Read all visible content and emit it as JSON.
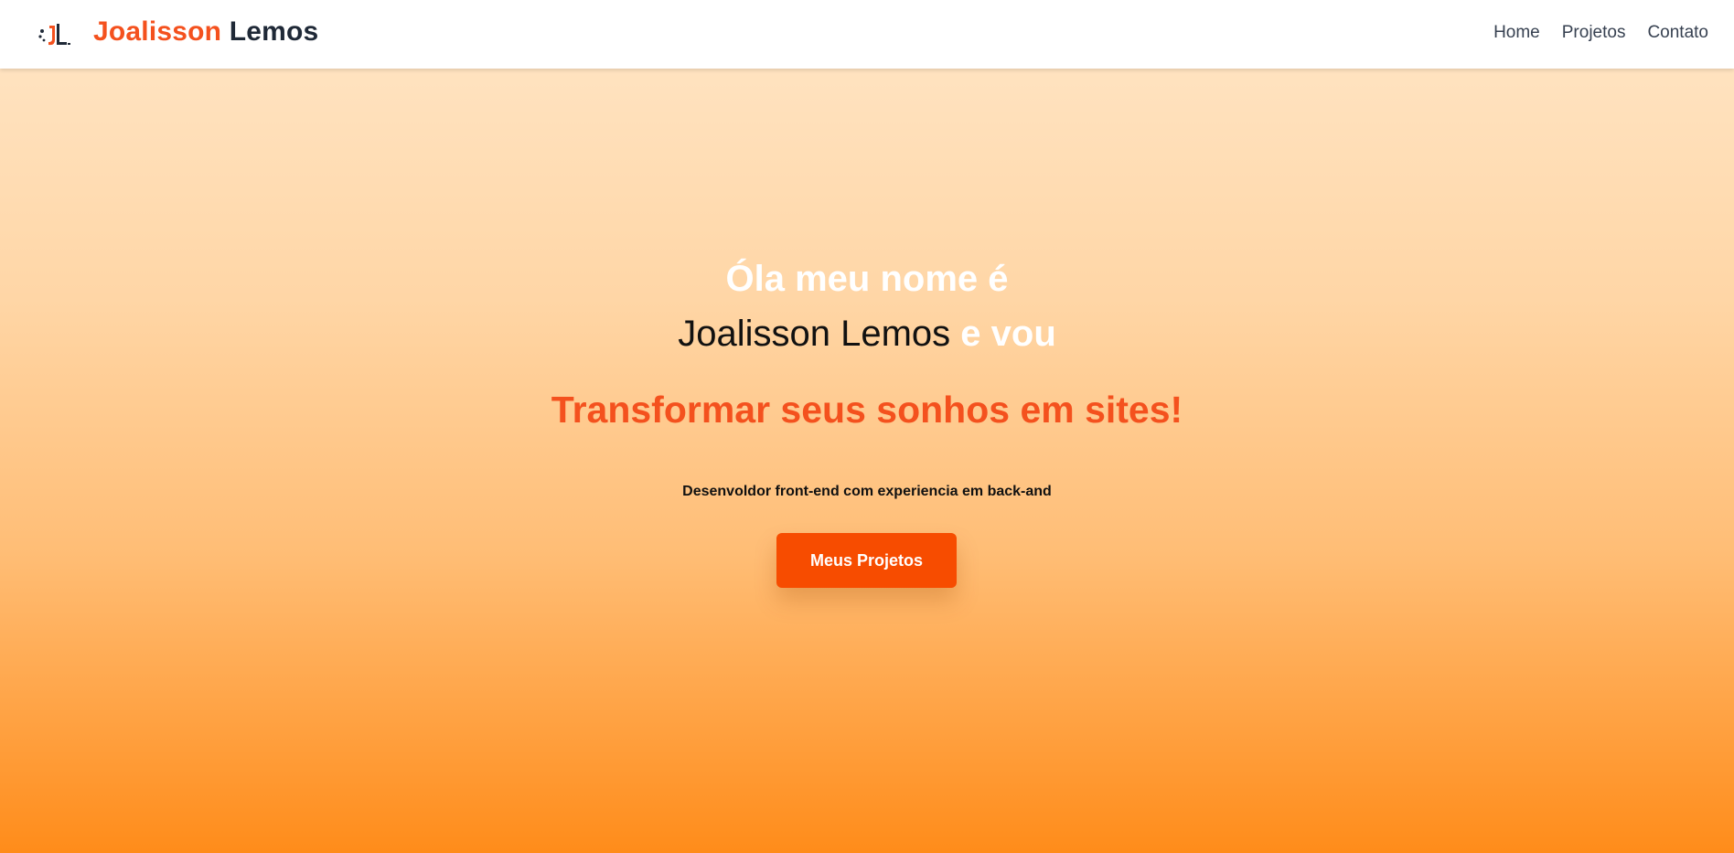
{
  "navbar": {
    "brand_first": "Joalisson",
    "brand_last": "Lemos",
    "logo_icon": "jl-monogram-logo",
    "links": [
      {
        "label": "Home"
      },
      {
        "label": "Projetos"
      },
      {
        "label": "Contato"
      }
    ]
  },
  "hero": {
    "greeting": "Óla meu nome é",
    "name": "Joalisson Lemos",
    "connector": "e vou",
    "tagline": "Transformar seus sonhos em sites!",
    "subtitle": "Desenvoldor front-end com experiencia em back-and",
    "cta_label": "Meus Projetos"
  },
  "colors": {
    "accent": "#f4511e",
    "cta": "#f74c00",
    "dark_text": "#1f2937",
    "gradient_top": "#ffe6c7",
    "gradient_bottom": "#ff8c1a"
  }
}
